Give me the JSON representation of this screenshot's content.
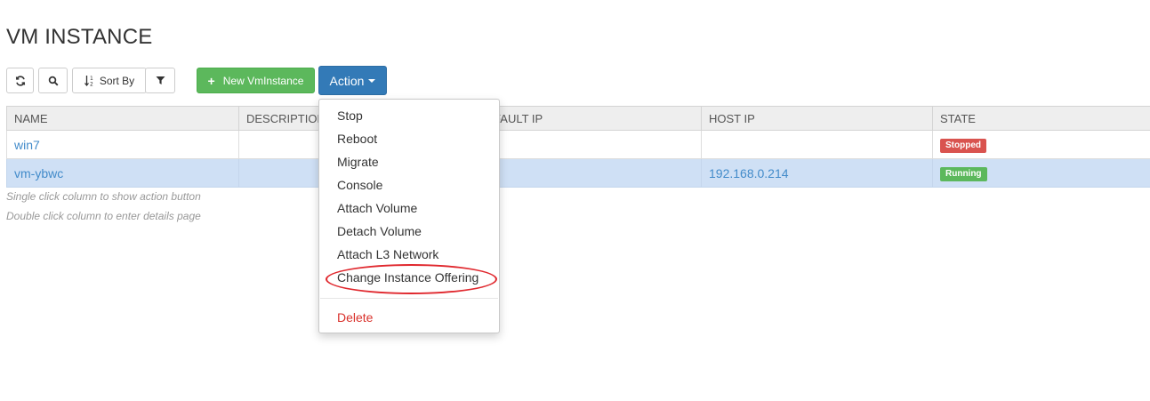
{
  "page": {
    "title": "VM INSTANCE"
  },
  "toolbar": {
    "sort_label": "Sort By",
    "new_label": "New VmInstance",
    "action_label": "Action",
    "new_color": "#5cb85c",
    "action_color": "#337ab7"
  },
  "table": {
    "columns": [
      "NAME",
      "DESCRIPTION",
      "DEFAULT IP",
      "HOST IP",
      "STATE"
    ],
    "rows": [
      {
        "name": "win7",
        "description": "",
        "default_ip": "",
        "host_ip": "",
        "state": "Stopped",
        "state_color": "#d9534f"
      },
      {
        "name": "vm-ybwc",
        "description": "",
        "default_ip": "",
        "host_ip": "192.168.0.214",
        "state": "Running",
        "state_color": "#5cb85c"
      }
    ]
  },
  "hints": {
    "single": "Single click column to show action button",
    "double": "Double click column to enter details page"
  },
  "action_menu": {
    "items": [
      "Stop",
      "Reboot",
      "Migrate",
      "Console",
      "Attach Volume",
      "Detach Volume",
      "Attach L3 Network",
      "Change Instance Offering"
    ],
    "delete_label": "Delete",
    "highlighted": "Change Instance Offering"
  }
}
